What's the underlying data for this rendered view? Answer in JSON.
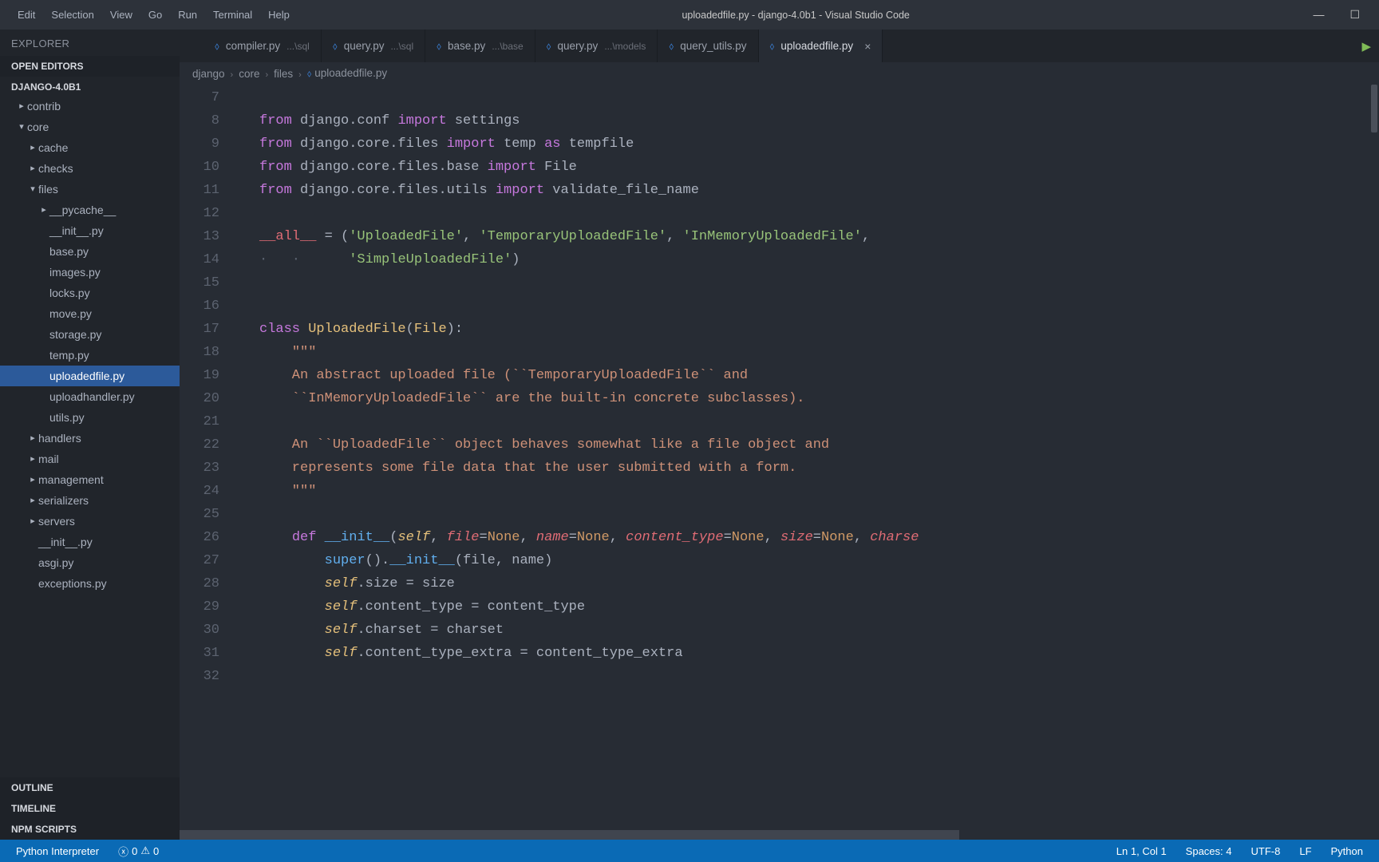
{
  "title": "uploadedfile.py - django-4.0b1 - Visual Studio Code",
  "menu": [
    "Edit",
    "Selection",
    "View",
    "Go",
    "Run",
    "Terminal",
    "Help"
  ],
  "sidebar": {
    "explorer": "EXPLORER",
    "open_editors": "OPEN EDITORS",
    "project": "DJANGO-4.0B1",
    "outline": "OUTLINE",
    "timeline": "TIMELINE",
    "npm": "NPM SCRIPTS",
    "tree": [
      {
        "label": "contrib",
        "depth": 0,
        "chev": "r"
      },
      {
        "label": "core",
        "depth": 0,
        "chev": "d"
      },
      {
        "label": "cache",
        "depth": 1,
        "chev": "r"
      },
      {
        "label": "checks",
        "depth": 1,
        "chev": "r"
      },
      {
        "label": "files",
        "depth": 1,
        "chev": "d"
      },
      {
        "label": "__pycache__",
        "depth": 2,
        "chev": "r"
      },
      {
        "label": "__init__.py",
        "depth": 2
      },
      {
        "label": "base.py",
        "depth": 2
      },
      {
        "label": "images.py",
        "depth": 2
      },
      {
        "label": "locks.py",
        "depth": 2
      },
      {
        "label": "move.py",
        "depth": 2
      },
      {
        "label": "storage.py",
        "depth": 2
      },
      {
        "label": "temp.py",
        "depth": 2
      },
      {
        "label": "uploadedfile.py",
        "depth": 2,
        "selected": true
      },
      {
        "label": "uploadhandler.py",
        "depth": 2
      },
      {
        "label": "utils.py",
        "depth": 2
      },
      {
        "label": "handlers",
        "depth": 1,
        "chev": "r"
      },
      {
        "label": "mail",
        "depth": 1,
        "chev": "r"
      },
      {
        "label": "management",
        "depth": 1,
        "chev": "r"
      },
      {
        "label": "serializers",
        "depth": 1,
        "chev": "r"
      },
      {
        "label": "servers",
        "depth": 1,
        "chev": "r"
      },
      {
        "label": "__init__.py",
        "depth": 1
      },
      {
        "label": "asgi.py",
        "depth": 1
      },
      {
        "label": "exceptions.py",
        "depth": 1
      }
    ]
  },
  "tabs": [
    {
      "file": "compiler.py",
      "dir": "...\\sql"
    },
    {
      "file": "query.py",
      "dir": "...\\sql"
    },
    {
      "file": "base.py",
      "dir": "...\\base"
    },
    {
      "file": "query.py",
      "dir": "...\\models"
    },
    {
      "file": "query_utils.py",
      "dir": ""
    },
    {
      "file": "uploadedfile.py",
      "dir": "",
      "active": true,
      "close": true
    }
  ],
  "breadcrumbs": [
    "django",
    "core",
    "files",
    "uploadedfile.py"
  ],
  "code_start_line": 7,
  "code_lines": [
    "",
    "<span class='kw'>from</span> django.conf <span class='kw'>import</span> settings",
    "<span class='kw'>from</span> django.core.files <span class='kw'>import</span> temp <span class='kw'>as</span> tempfile",
    "<span class='kw'>from</span> django.core.files.base <span class='kw'>import</span> File",
    "<span class='kw'>from</span> django.core.files.utils <span class='kw'>import</span> validate_file_name",
    "",
    "<span class='va'>__all__</span> <span class='op'>=</span> (<span class='str'>'UploadedFile'</span>, <span class='str'>'TemporaryUploadedFile'</span>, <span class='str'>'InMemoryUploadedFile'</span>,",
    "<span class='wg'>·   ·   </span>   <span class='str'>'SimpleUploadedFile'</span>)",
    "",
    "",
    "<span class='kw'>class</span> <span class='cls'>UploadedFile</span>(<span class='cls'>File</span>):",
    "    <span class='ds'>\"\"\"</span>",
    "<span class='ds'>    An abstract uploaded file (``TemporaryUploadedFile`` and</span>",
    "<span class='ds'>    ``InMemoryUploadedFile`` are the built-in concrete subclasses).</span>",
    "",
    "<span class='ds'>    An ``UploadedFile`` object behaves somewhat like a file object and</span>",
    "<span class='ds'>    represents some file data that the user submitted with a form.</span>",
    "<span class='ds'>    \"\"\"</span>",
    "",
    "    <span class='kw'>def</span> <span class='fn'>__init__</span>(<span class='sl'>self</span>, <span class='pa'>file</span><span class='op'>=</span><span class='bi'>None</span>, <span class='pa'>name</span><span class='op'>=</span><span class='bi'>None</span>, <span class='pa'>content_type</span><span class='op'>=</span><span class='bi'>None</span>, <span class='pa'>size</span><span class='op'>=</span><span class='bi'>None</span>, <span class='pa'>charse</span>",
    "        <span class='fn'>super</span>().<span class='fn'>__init__</span>(file, name)",
    "        <span class='sl'>self</span>.size <span class='op'>=</span> size",
    "        <span class='sl'>self</span>.content_type <span class='op'>=</span> content_type",
    "        <span class='sl'>self</span>.charset <span class='op'>=</span> charset",
    "        <span class='sl'>self</span>.content_type_extra <span class='op'>=</span> content_type_extra",
    ""
  ],
  "status": {
    "interpreter": "Python Interpreter",
    "errors": "0",
    "warnings": "0",
    "pos": "Ln 1, Col 1",
    "spaces": "Spaces: 4",
    "enc": "UTF-8",
    "eol": "LF",
    "lang": "Python"
  }
}
